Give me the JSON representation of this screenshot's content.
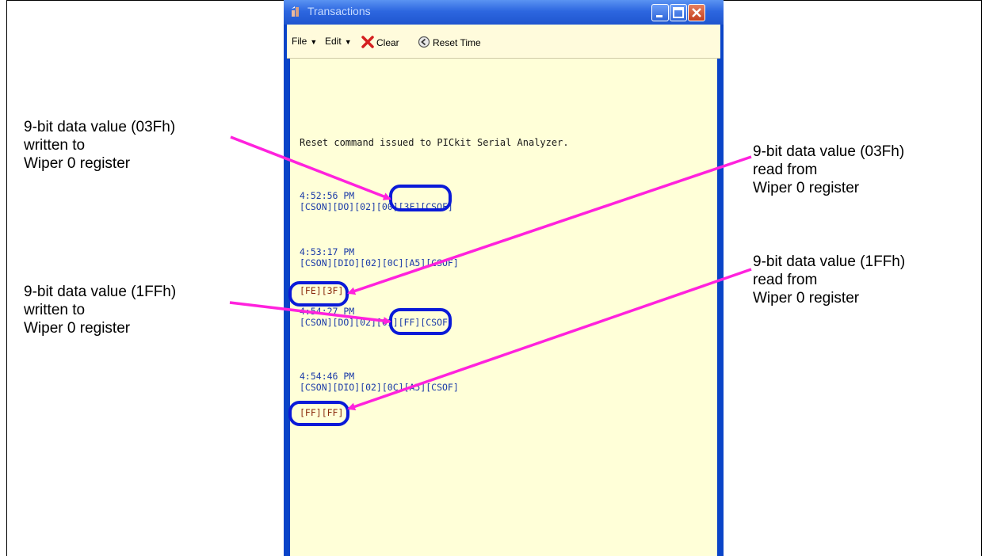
{
  "window": {
    "title": "Transactions",
    "menu": {
      "file": "File",
      "edit": "Edit",
      "clear": "Clear",
      "reset_time": "Reset Time"
    }
  },
  "log": {
    "reset_message": "Reset command issued to PICkit Serial Analyzer.",
    "entries": [
      {
        "time": "4:52:56 PM",
        "data": "[CSON][DO][02][00][3F][CSOF]"
      },
      {
        "time": "4:53:17 PM",
        "data": "[CSON][DIO][02][0C][A5][CSOF]",
        "read": "[FE][3F]"
      },
      {
        "time": "4:54:27 PM",
        "data": "[CSON][DO][02][01][FF][CSOF]"
      },
      {
        "time": "4:54:46 PM",
        "data": "[CSON][DIO][02][0C][A5][CSOF]",
        "read": "[FF][FF]"
      }
    ]
  },
  "callouts": {
    "write_03f": [
      "9-bit data value (03Fh)",
      "written to",
      "Wiper 0 register"
    ],
    "write_1ff": [
      "9-bit data value (1FFh)",
      "written to",
      "Wiper 0 register"
    ],
    "read_03f": [
      "9-bit data value (03Fh)",
      "read from",
      "Wiper 0 register"
    ],
    "read_1ff": [
      "9-bit data value (1FFh)",
      "read from",
      "Wiper 0 register"
    ]
  },
  "colors": {
    "arrow": "#ff22dd",
    "highlight": "#0a1ad8",
    "log_text": "#1a3aa8",
    "read_text": "#8a2b0c"
  },
  "icons": {
    "title": "transactions-icon",
    "clear": "red-x-icon",
    "reset_time": "clock-reset-icon"
  }
}
